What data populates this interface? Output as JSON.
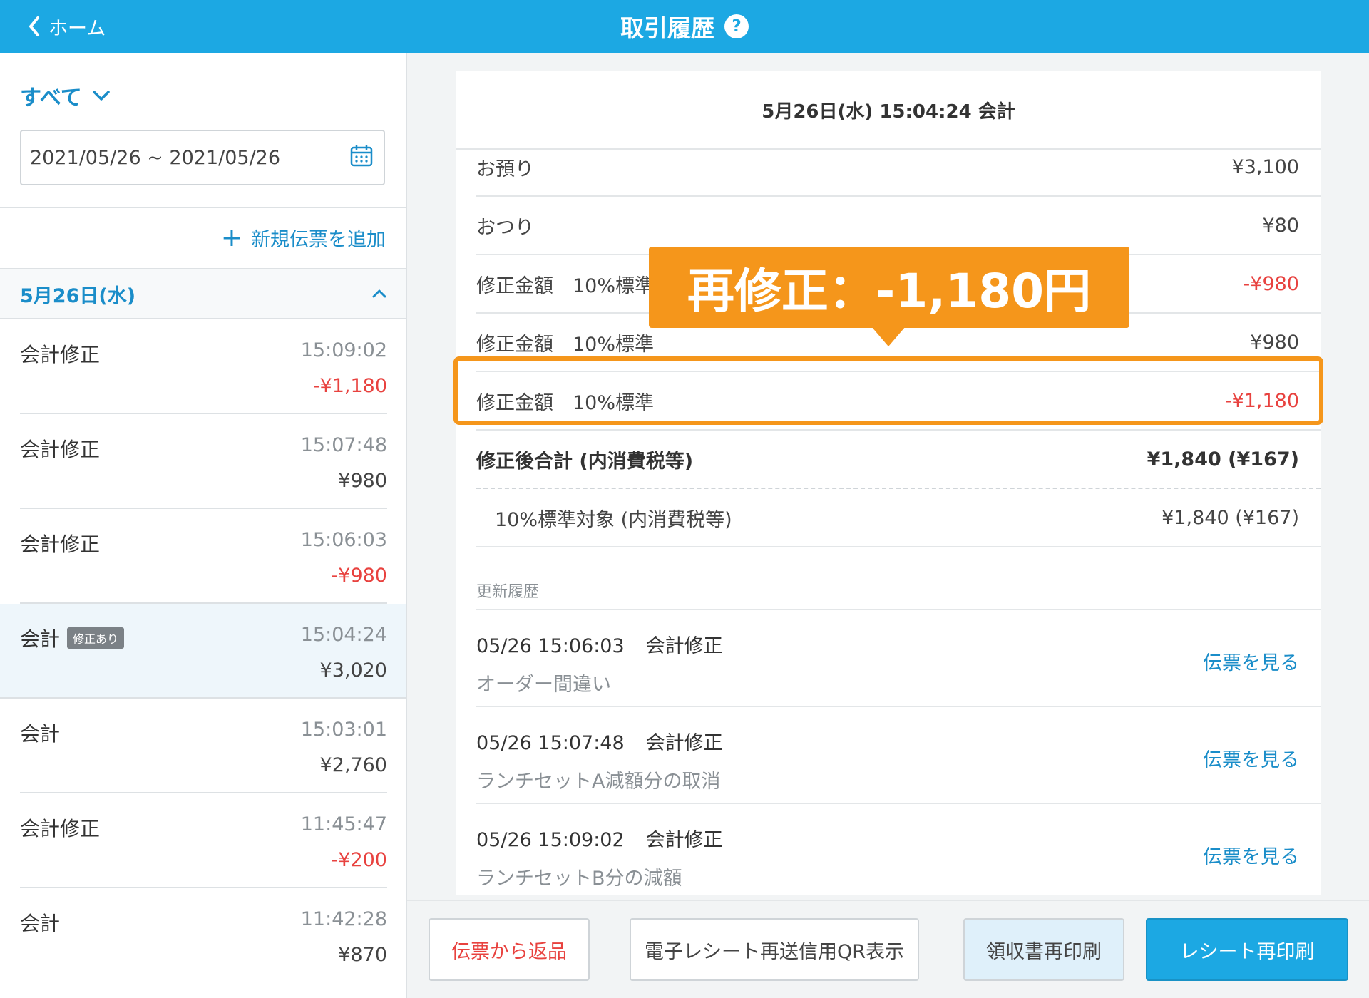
{
  "header": {
    "back_label": "ホーム",
    "title": "取引履歴",
    "help_symbol": "?"
  },
  "sidebar": {
    "filter_label": "すべて",
    "date_range": "2021/05/26 ~ 2021/05/26",
    "add_slip_label": "新規伝票を追加",
    "day_header": "5月26日(水)",
    "transactions": [
      {
        "label": "会計修正",
        "badge": "",
        "time": "15:09:02",
        "amount": "-¥1,180",
        "negative": true
      },
      {
        "label": "会計修正",
        "badge": "",
        "time": "15:07:48",
        "amount": "¥980",
        "negative": false
      },
      {
        "label": "会計修正",
        "badge": "",
        "time": "15:06:03",
        "amount": "-¥980",
        "negative": true
      },
      {
        "label": "会計",
        "badge": "修正あり",
        "time": "15:04:24",
        "amount": "¥3,020",
        "negative": false
      },
      {
        "label": "会計",
        "badge": "",
        "time": "15:03:01",
        "amount": "¥2,760",
        "negative": false
      },
      {
        "label": "会計修正",
        "badge": "",
        "time": "11:45:47",
        "amount": "-¥200",
        "negative": true
      },
      {
        "label": "会計",
        "badge": "",
        "time": "11:42:28",
        "amount": "¥870",
        "negative": false
      }
    ]
  },
  "detail": {
    "title": "5月26日(水) 15:04:24 会計",
    "rows": [
      {
        "label": "お預り",
        "value": "¥3,100"
      },
      {
        "label": "おつり",
        "value": "¥80"
      },
      {
        "label": "修正金額　10%標準",
        "value": "-¥980"
      },
      {
        "label": "修正金額　10%標準",
        "value": "¥980"
      },
      {
        "label": "修正金額　10%標準",
        "value": "-¥1,180"
      }
    ],
    "total_label": "修正後合計 (内消費税等)",
    "total_value": "¥1,840 (¥167)",
    "tax_label": "10%標準対象 (内消費税等)",
    "tax_value": "¥1,840 (¥167)",
    "history_label": "更新履歴",
    "history": [
      {
        "datetime": "05/26 15:06:03",
        "type": "会計修正",
        "note": "オーダー間違い",
        "link": "伝票を見る"
      },
      {
        "datetime": "05/26 15:07:48",
        "type": "会計修正",
        "note": "ランチセットA減額分の取消",
        "link": "伝票を見る"
      },
      {
        "datetime": "05/26 15:09:02",
        "type": "会計修正",
        "note": "ランチセットB分の減額",
        "link": "伝票を見る"
      }
    ]
  },
  "callout": {
    "text": "再修正：-1,180円"
  },
  "actions": {
    "return_label": "伝票から返品",
    "qr_label": "電子レシート再送信用QR表示",
    "receipt_label": "領収書再印刷",
    "reprint_label": "レシート再印刷"
  },
  "colors": {
    "brand": "#1ca8e3",
    "link": "#1a8dc9",
    "negative": "#e8423f",
    "highlight": "#f5961b"
  }
}
